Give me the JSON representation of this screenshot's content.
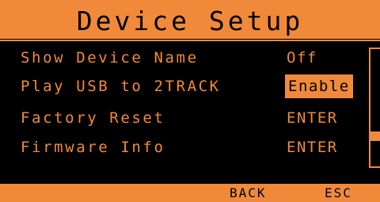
{
  "header": {
    "title": "Device Setup"
  },
  "menu": {
    "items": [
      {
        "label": "Show Device Name",
        "value": "Off"
      },
      {
        "label": "Play USB to 2TRACK",
        "value": "Enable",
        "selected": true
      },
      {
        "label": "Factory Reset",
        "value": "ENTER"
      },
      {
        "label": "Firmware Info",
        "value": "ENTER"
      }
    ]
  },
  "footer": {
    "back_label": "BACK",
    "esc_label": "ESC"
  },
  "colors": {
    "accent": "#f08a3a",
    "background": "#000000"
  }
}
